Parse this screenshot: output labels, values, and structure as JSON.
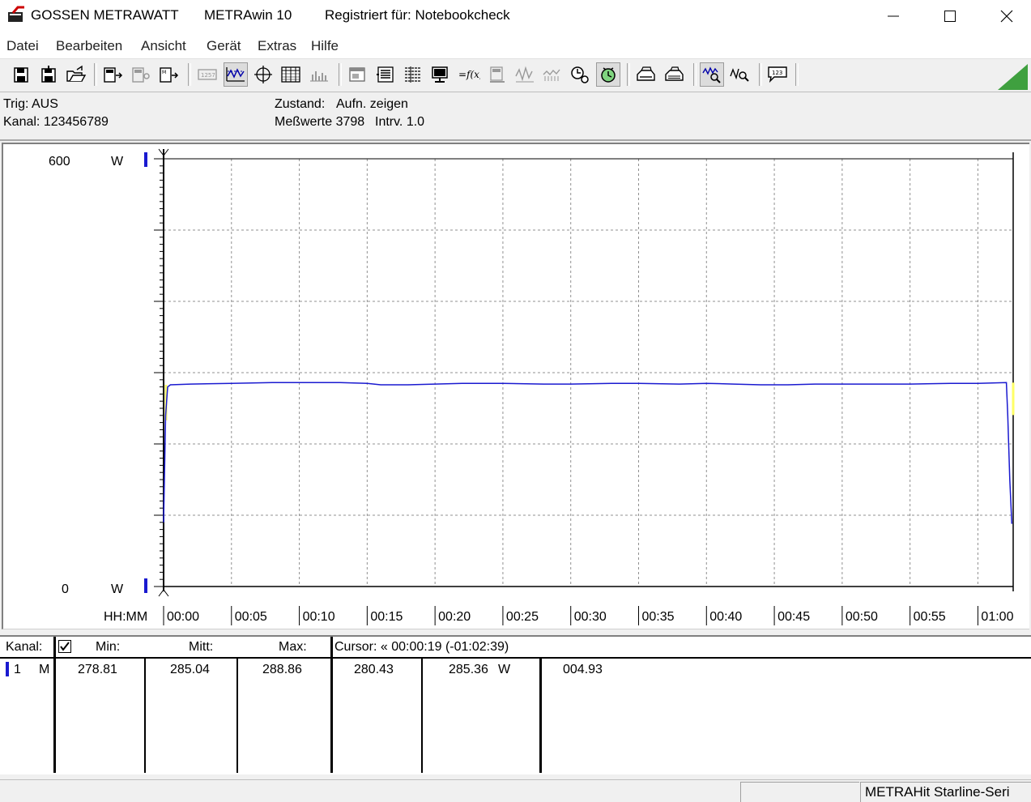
{
  "window": {
    "app_name": "GOSSEN METRAWATT",
    "product": "METRAwin 10",
    "registered": "Registriert für: Notebookcheck"
  },
  "menu": [
    "Datei",
    "Bearbeiten",
    "Ansicht",
    "Gerät",
    "Extras",
    "Hilfe"
  ],
  "toolbar": {
    "buttons": [
      "save-disk-icon",
      "save-as-disk-icon",
      "open-folder-icon",
      "device-read-icon",
      "device-disabled-icon",
      "device-memory-icon",
      "display-disabled-icon",
      "waveform-icon",
      "crosshair-icon",
      "table-icon",
      "bargraph-disabled-icon",
      "window-icon",
      "list-icon",
      "list-detail-icon",
      "monitor-icon",
      "formula-icon",
      "meter-disabled-icon",
      "wave-disabled-icon",
      "trend-disabled-icon",
      "clock-settings-icon",
      "clock-pressed-icon",
      "print-icon",
      "print-preview-icon",
      "zoom-waveform-icon",
      "zoom-search-icon",
      "message-icon"
    ]
  },
  "info": {
    "trig": "Trig: AUS",
    "kanal": "Kanal: 123456789",
    "zustand_label": "Zustand:",
    "zustand_value": "Aufn. zeigen",
    "messwerte": "Meßwerte 3798",
    "intrv": "Intrv. 1.0"
  },
  "chart_data": {
    "type": "line",
    "y_top_label": "600",
    "y_bottom_label": "0",
    "y_unit": "W",
    "ylim": [
      0,
      600
    ],
    "x_axis_label": "HH:MM",
    "x_ticks": [
      "00:00",
      "00:05",
      "00:10",
      "00:15",
      "00:20",
      "00:25",
      "00:30",
      "00:35",
      "00:40",
      "00:45",
      "00:50",
      "00:55",
      "01:00"
    ],
    "xlim_minutes": [
      0,
      62.6
    ],
    "grid": true,
    "series": [
      {
        "color": "#1a1ad0",
        "x": [
          0,
          0.15,
          0.3,
          0.5,
          2,
          5,
          8,
          10,
          13,
          15,
          16,
          18,
          20,
          22,
          25,
          28,
          30,
          33,
          35,
          38,
          40,
          42,
          44,
          46,
          48,
          50,
          53,
          55,
          58,
          60,
          62.1,
          62.2,
          62.35,
          62.5
        ],
        "y": [
          90,
          240,
          280,
          283,
          284,
          285,
          286,
          286,
          286,
          285,
          283,
          283,
          284,
          285,
          285,
          284,
          284,
          285,
          285,
          284,
          285,
          284,
          283,
          283,
          284,
          284,
          284,
          284,
          285,
          285,
          286,
          240,
          150,
          88
        ]
      }
    ],
    "cursor_markers": [
      "yellow",
      "yellow"
    ]
  },
  "table": {
    "headers": {
      "kanal": "Kanal:",
      "min": "Min:",
      "mitt": "Mitt:",
      "max": "Max:",
      "cursor": "Cursor: « 00:00:19 (-01:02:39)"
    },
    "row": {
      "channel": "1",
      "mode": "M",
      "min": "278.81",
      "mitt": "285.04",
      "max": "288.86",
      "cursor_value": "280.43",
      "value2": "285.36",
      "unit": "W",
      "value3": "004.93"
    }
  },
  "status": {
    "device": "METRAHit Starline-Seri"
  }
}
